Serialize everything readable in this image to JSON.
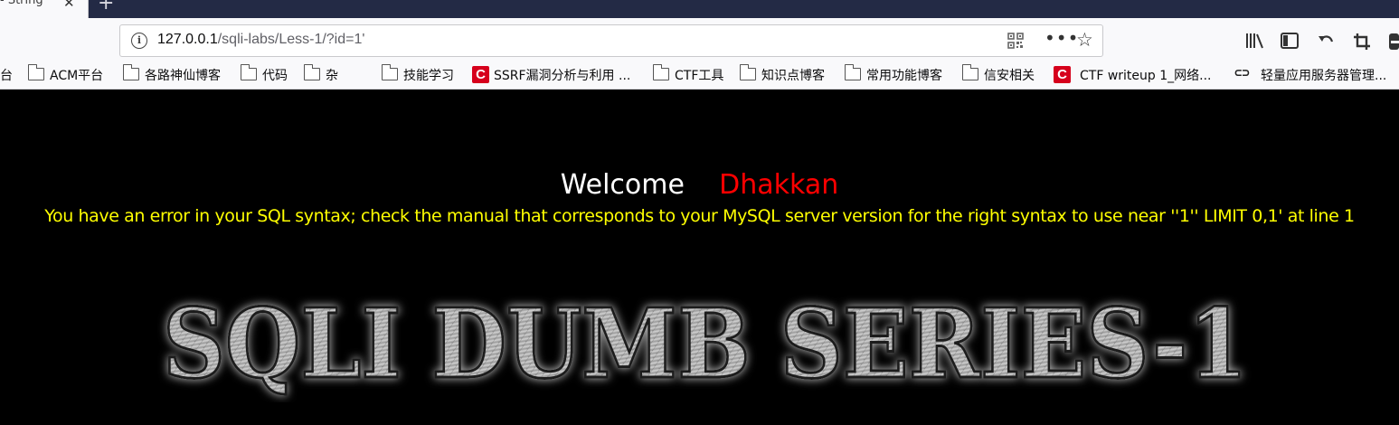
{
  "browser": {
    "tab_title": "- String",
    "tab_close": "✕",
    "new_tab": "+",
    "url_host": "127.0.0.1",
    "url_path": "/sqli-labs/Less-1/?id=1'"
  },
  "bookmarks": [
    {
      "label": "台",
      "icon": "none"
    },
    {
      "label": "ACM平台",
      "icon": "folder-icon"
    },
    {
      "label": "各路神仙博客",
      "icon": "folder-icon"
    },
    {
      "label": "代码",
      "icon": "folder-icon"
    },
    {
      "label": "杂",
      "icon": "folder-icon"
    },
    {
      "label": "技能学习",
      "icon": "folder-icon"
    },
    {
      "label": "SSRF漏洞分析与利用 ...",
      "icon": "csdn-icon"
    },
    {
      "label": "CTF工具",
      "icon": "folder-icon"
    },
    {
      "label": "知识点博客",
      "icon": "folder-icon"
    },
    {
      "label": "常用功能博客",
      "icon": "folder-icon"
    },
    {
      "label": "信安相关",
      "icon": "folder-icon"
    },
    {
      "label": "CTF writeup 1_网络...",
      "icon": "csdn-icon"
    },
    {
      "label": "轻量应用服务器管理...",
      "icon": "link-icon"
    }
  ],
  "page": {
    "welcome_text": "Welcome",
    "welcome_name": "Dhakkan",
    "sql_error": "You have an error in your SQL syntax; check the manual that corresponds to your MySQL server version for the right syntax to use near ''1'' LIMIT 0,1' at line 1",
    "banner_text": "SQLI DUMB SERIES-1"
  },
  "colors": {
    "page_background": "#000000",
    "welcome_name": "#ff0000",
    "sql_error": "#ffff00",
    "csdn_brand": "#d6001c"
  }
}
